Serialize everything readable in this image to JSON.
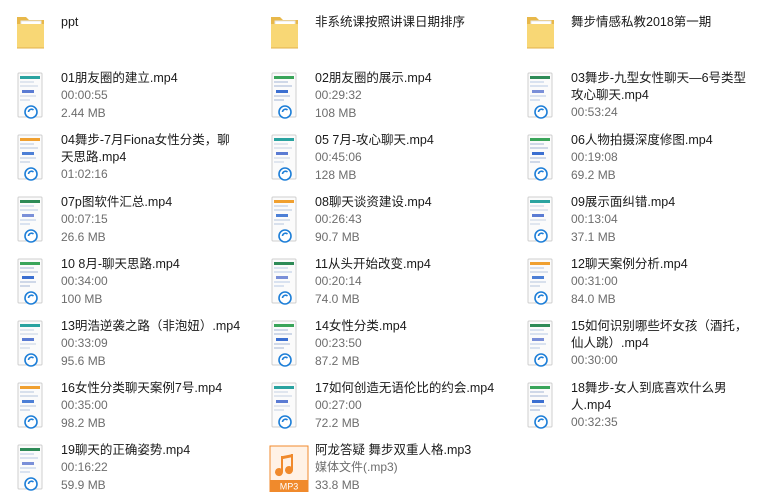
{
  "items": [
    {
      "kind": "folder",
      "name": "ppt"
    },
    {
      "kind": "folder",
      "name": "非系统课按照讲课日期排序"
    },
    {
      "kind": "folder",
      "name": "舞步情感私教2018第一期"
    },
    {
      "kind": "video",
      "name": "01朋友圈的建立.mp4",
      "duration": "00:00:55",
      "size": "2.44 MB"
    },
    {
      "kind": "video",
      "name": "02朋友圈的展示.mp4",
      "duration": "00:29:32",
      "size": "108 MB"
    },
    {
      "kind": "video",
      "name": "03舞步-九型女性聊天—6号类型攻心聊天.mp4",
      "duration": "00:53:24",
      "size": ""
    },
    {
      "kind": "video",
      "name": "04舞步-7月Fiona女性分类，聊天思路.mp4",
      "duration": "01:02:16",
      "size": ""
    },
    {
      "kind": "video",
      "name": "05 7月-攻心聊天.mp4",
      "duration": "00:45:06",
      "size": "128 MB"
    },
    {
      "kind": "video",
      "name": "06人物拍摄深度修图.mp4",
      "duration": "00:19:08",
      "size": "69.2 MB"
    },
    {
      "kind": "video",
      "name": "07p图软件汇总.mp4",
      "duration": "00:07:15",
      "size": "26.6 MB"
    },
    {
      "kind": "video",
      "name": "08聊天谈资建设.mp4",
      "duration": "00:26:43",
      "size": "90.7 MB"
    },
    {
      "kind": "video",
      "name": "09展示面纠错.mp4",
      "duration": "00:13:04",
      "size": "37.1 MB"
    },
    {
      "kind": "video",
      "name": "10 8月-聊天思路.mp4",
      "duration": "00:34:00",
      "size": "100 MB"
    },
    {
      "kind": "video",
      "name": "11从头开始改变.mp4",
      "duration": "00:20:14",
      "size": "74.0 MB"
    },
    {
      "kind": "video",
      "name": "12聊天案例分析.mp4",
      "duration": "00:31:00",
      "size": "84.0 MB"
    },
    {
      "kind": "video",
      "name": "13明浩逆袭之路（非泡妞）.mp4",
      "duration": "00:33:09",
      "size": "95.6 MB"
    },
    {
      "kind": "video",
      "name": "14女性分类.mp4",
      "duration": "00:23:50",
      "size": "87.2 MB"
    },
    {
      "kind": "video",
      "name": "15如何识别哪些坏女孩（酒托，仙人跳）.mp4",
      "duration": "00:30:00",
      "size": ""
    },
    {
      "kind": "video",
      "name": "16女性分类聊天案例7号.mp4",
      "duration": "00:35:00",
      "size": "98.2 MB"
    },
    {
      "kind": "video",
      "name": "17如何创造无语伦比的约会.mp4",
      "duration": "00:27:00",
      "size": "72.2 MB"
    },
    {
      "kind": "video",
      "name": "18舞步-女人到底喜欢什么男人.mp4",
      "duration": "00:32:35",
      "size": ""
    },
    {
      "kind": "video",
      "name": "19聊天的正确姿势.mp4",
      "duration": "00:16:22",
      "size": "59.9 MB"
    },
    {
      "kind": "audio",
      "name": "阿龙答疑 舞步双重人格.mp3",
      "duration": "媒体文件(.mp3)",
      "size": "33.8 MB",
      "badge": "MP3"
    }
  ],
  "colors": {
    "folder_back": "#e8b84a",
    "folder_front": "#f8d775",
    "audio_orange": "#f08a2c"
  }
}
